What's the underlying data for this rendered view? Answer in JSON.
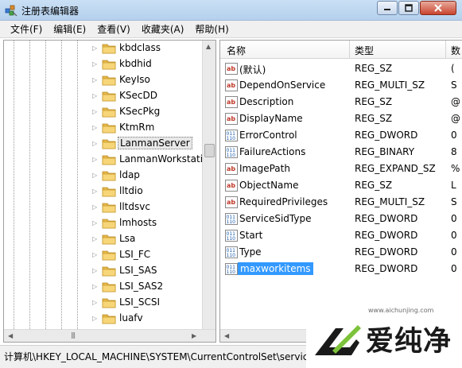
{
  "window": {
    "title": "注册表编辑器"
  },
  "menu": [
    "文件(F)",
    "编辑(E)",
    "查看(V)",
    "收藏夹(A)",
    "帮助(H)"
  ],
  "tree": {
    "items": [
      {
        "label": "kbdclass",
        "selected": false
      },
      {
        "label": "kbdhid",
        "selected": false
      },
      {
        "label": "KeyIso",
        "selected": false
      },
      {
        "label": "KSecDD",
        "selected": false
      },
      {
        "label": "KSecPkg",
        "selected": false
      },
      {
        "label": "KtmRm",
        "selected": false
      },
      {
        "label": "LanmanServer",
        "selected": true
      },
      {
        "label": "LanmanWorkstation",
        "selected": false
      },
      {
        "label": "ldap",
        "selected": false
      },
      {
        "label": "lltdio",
        "selected": false
      },
      {
        "label": "lltdsvc",
        "selected": false
      },
      {
        "label": "lmhosts",
        "selected": false
      },
      {
        "label": "Lsa",
        "selected": false
      },
      {
        "label": "LSI_FC",
        "selected": false
      },
      {
        "label": "LSI_SAS",
        "selected": false
      },
      {
        "label": "LSI_SAS2",
        "selected": false
      },
      {
        "label": "LSI_SCSI",
        "selected": false
      },
      {
        "label": "luafv",
        "selected": false
      }
    ],
    "scroll_grip": "|||"
  },
  "list": {
    "columns": {
      "name": "名称",
      "type": "类型",
      "data": "数"
    },
    "rows": [
      {
        "icon": "string-value-icon",
        "name": "(默认)",
        "type": "REG_SZ",
        "data": "(",
        "selected": false
      },
      {
        "icon": "string-value-icon",
        "name": "DependOnService",
        "type": "REG_MULTI_SZ",
        "data": "S",
        "selected": false
      },
      {
        "icon": "string-value-icon",
        "name": "Description",
        "type": "REG_SZ",
        "data": "@",
        "selected": false
      },
      {
        "icon": "string-value-icon",
        "name": "DisplayName",
        "type": "REG_SZ",
        "data": "@",
        "selected": false
      },
      {
        "icon": "binary-value-icon",
        "name": "ErrorControl",
        "type": "REG_DWORD",
        "data": "0",
        "selected": false
      },
      {
        "icon": "binary-value-icon",
        "name": "FailureActions",
        "type": "REG_BINARY",
        "data": "8",
        "selected": false
      },
      {
        "icon": "string-value-icon",
        "name": "ImagePath",
        "type": "REG_EXPAND_SZ",
        "data": "%",
        "selected": false
      },
      {
        "icon": "string-value-icon",
        "name": "ObjectName",
        "type": "REG_SZ",
        "data": "L",
        "selected": false
      },
      {
        "icon": "string-value-icon",
        "name": "RequiredPrivileges",
        "type": "REG_MULTI_SZ",
        "data": "S",
        "selected": false
      },
      {
        "icon": "binary-value-icon",
        "name": "ServiceSidType",
        "type": "REG_DWORD",
        "data": "0",
        "selected": false
      },
      {
        "icon": "binary-value-icon",
        "name": "Start",
        "type": "REG_DWORD",
        "data": "0",
        "selected": false
      },
      {
        "icon": "binary-value-icon",
        "name": "Type",
        "type": "REG_DWORD",
        "data": "0",
        "selected": false
      },
      {
        "icon": "binary-value-icon",
        "name": "maxworkitems",
        "type": "REG_DWORD",
        "data": "0",
        "selected": true
      }
    ]
  },
  "status": {
    "path": "计算机\\HKEY_LOCAL_MACHINE\\SYSTEM\\CurrentControlSet\\servic"
  },
  "watermark": {
    "url": "www.aichunjing.com",
    "brand": "爱纯净"
  },
  "colors": {
    "selection": "#3399ff",
    "titlebar": "#c9dff4",
    "close_button": "#c8452f"
  }
}
